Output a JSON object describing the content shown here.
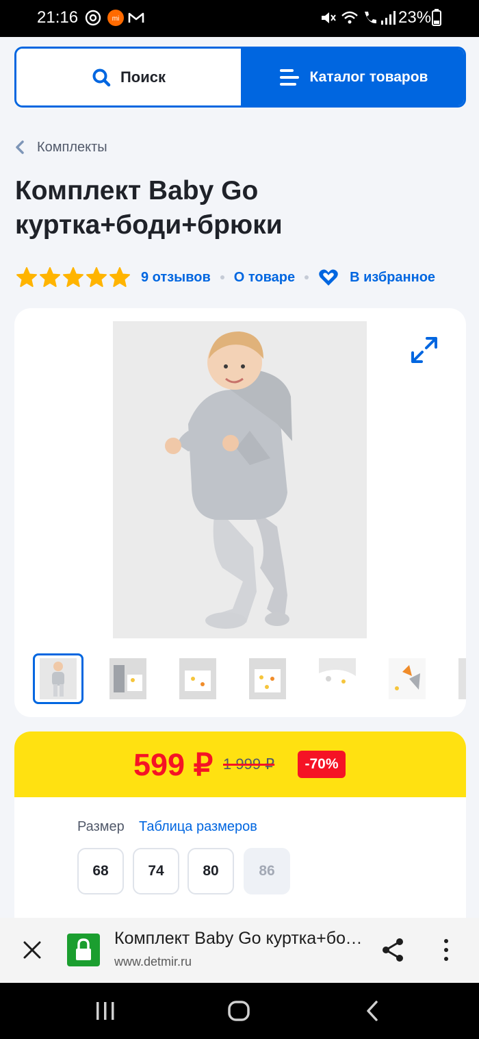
{
  "status_bar": {
    "time": "21:16",
    "battery": "23%"
  },
  "header": {
    "search_label": "Поиск",
    "catalog_label": "Каталог товаров"
  },
  "breadcrumb": {
    "label": "Комплекты"
  },
  "product": {
    "title_line1": "Комплект Baby Go",
    "title_line2": "куртка+боди+брюки",
    "rating_stars": 5,
    "reviews_link": "9 отзывов",
    "about_link": "О товаре",
    "favorite_link": "В избранное",
    "thumbnails_count": 7
  },
  "price": {
    "current": "599 ₽",
    "old": "1 999 ₽",
    "discount": "-70%"
  },
  "sizes": {
    "label": "Размер",
    "table_link": "Таблица размеров",
    "options": [
      {
        "value": "68",
        "available": true
      },
      {
        "value": "74",
        "available": true
      },
      {
        "value": "80",
        "available": true
      },
      {
        "value": "86",
        "available": false
      }
    ]
  },
  "browser": {
    "tab_title": "Комплект Baby Go куртка+боди+брюки",
    "url": "www.detmir.ru"
  },
  "colors": {
    "brand_blue": "#0066e0",
    "price_red": "#f51325",
    "price_band_yellow": "#ffe111",
    "star_yellow": "#ffb400"
  }
}
